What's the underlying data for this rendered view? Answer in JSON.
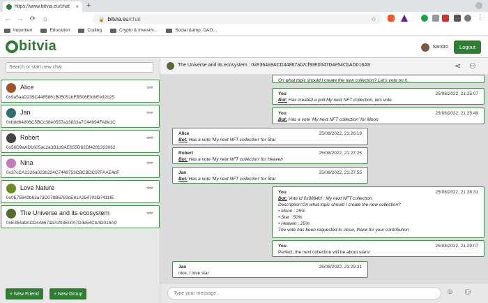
{
  "browser": {
    "tab_title": "https://www.bitvia.eu/chat",
    "tab_close": "×",
    "new_tab": "+",
    "address_host": "bitvia.eu",
    "address_path": "/chat",
    "back": "←",
    "forward": "→",
    "reload": "⟳",
    "home": "⌂",
    "star": "☆"
  },
  "bookmarks": [
    {
      "label": "Importiert"
    },
    {
      "label": "Education"
    },
    {
      "label": "Coding"
    },
    {
      "label": "Crypto & Investm..."
    },
    {
      "label": "Social &amp; DAO..."
    }
  ],
  "app": {
    "logo_text": "bitvia",
    "user_name": "Sandro",
    "logout_label": "Logout"
  },
  "sidebar": {
    "search_placeholder": "Search or start new chat",
    "contacts": [
      {
        "name": "Alice",
        "address": "0x9a5aaD239C4485861B05051bFB506EfdbEe92b25",
        "avatar_color": "#a0522d"
      },
      {
        "name": "Jan",
        "address": "0xb8d64806C5BCc38e0557a13833a7C44994FA8e1C",
        "avatar_color": "#2f6f6f"
      },
      {
        "name": "Robert",
        "address": "0x56D9aAD1605ac2a3B1d9AE655D62Df4281333082",
        "avatar_color": "#444444"
      },
      {
        "name": "Nina",
        "address": "0x37cCA2226a023b224C7448753CBCBDC97FAAE4dF",
        "avatar_color": "#c77dba"
      },
      {
        "name": "Love Nature",
        "address": "0x0E75842b63a73D079B6783cE61A254703D7411fE",
        "avatar_color": "#6b8e23"
      },
      {
        "name": "The Universe and its ecosystem",
        "address": "0xE364a9ACD44867ab7cf93E0047D4e54CbAD016A9",
        "avatar_color": "#556b2f"
      }
    ],
    "new_friend_label": "+ New Friend",
    "new_group_label": "+ New Group"
  },
  "chat": {
    "title": "The Universe and its ecosystem : 0xE364a9ACD44867ab7cf93E0047D4e54CbAD016A9",
    "share_icon": "⟨",
    "members_icon": "⚇",
    "messages": [
      {
        "sender": "",
        "time": "",
        "lines": [
          {
            "text": "On what topic should I create the new collection? Let's vote on it."
          }
        ]
      },
      {
        "sender": "You",
        "time": "25/08/2022, 21:25:07",
        "lines": [
          {
            "bot": "Bot:",
            "text": " Has created a poll:My next NFT collection, lets vote"
          }
        ]
      },
      {
        "sender": "You",
        "time": "25/08/2022, 21:25:49",
        "lines": [
          {
            "bot": "Bot:",
            "text": " Has a vote 'My next NFT collection' for Moon"
          }
        ]
      },
      {
        "sender": "Alice",
        "time": "25/08/2022, 21:26:19",
        "lines": [
          {
            "bot": "Bot:",
            "text": " Has a vote 'My next NFT collection' for Star"
          }
        ]
      },
      {
        "sender": "Robert",
        "time": "25/08/2022, 21:27:25",
        "lines": [
          {
            "bot": "Bot:",
            "text": " Has a vote 'My next NFT collection' for Heaven"
          }
        ]
      },
      {
        "sender": "Jan",
        "time": "25/08/2022, 21:27:55",
        "lines": [
          {
            "bot": "Bot:",
            "text": " Has a vote 'My next NFT collection' for Star"
          }
        ]
      },
      {
        "sender": "You",
        "time": "25/08/2022, 21:28:31",
        "lines": [
          {
            "bot": "Bot:",
            "text": " Vote id 0x0884cf : My next NFT collection"
          },
          {
            "text": "Description:On what topic should I create the new collection?"
          },
          {
            "text": "• Moon : 25%"
          },
          {
            "text": "• Star : 50%"
          },
          {
            "text": "• Heaven : 25%"
          },
          {
            "text": "The vote has been requested to close, thank for your contribution"
          }
        ]
      },
      {
        "sender": "You",
        "time": "25/08/2022, 21:29:07",
        "lines": [
          {
            "plain": "Perfect, the next collection will be about stars!"
          }
        ]
      },
      {
        "sender": "Jan",
        "time": "25/08/2022, 21:29:31",
        "lines": [
          {
            "plain": "nice, I love star"
          }
        ]
      }
    ]
  },
  "composer": {
    "placeholder": "Type your message..",
    "emoji_icon": "☺",
    "money_icon": "⚇"
  },
  "colors": {
    "brand": "#2e7d32",
    "message_border": "#4a8f4f"
  }
}
